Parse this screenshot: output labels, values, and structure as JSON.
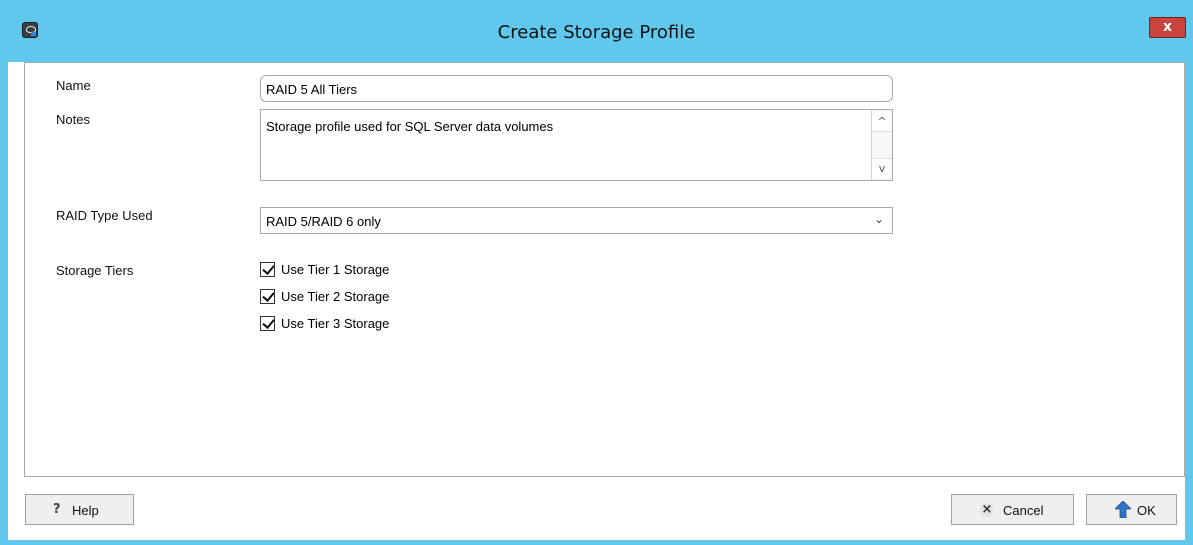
{
  "window": {
    "title": "Create Storage Profile",
    "close_label": "x",
    "titlebar_color": "#60c8ec"
  },
  "form": {
    "name_label": "Name",
    "name_value": "RAID 5 All Tiers",
    "notes_label": "Notes",
    "notes_value": "Storage profile used for SQL Server data volumes",
    "raid_label": "RAID Type Used",
    "raid_value": "RAID 5/RAID 6 only",
    "tiers_label": "Storage Tiers",
    "tiers": [
      {
        "label": "Use Tier 1 Storage",
        "checked": true
      },
      {
        "label": "Use Tier 2 Storage",
        "checked": true
      },
      {
        "label": "Use Tier 3 Storage",
        "checked": true
      }
    ]
  },
  "buttons": {
    "help": "Help",
    "cancel": "Cancel",
    "ok": "OK"
  },
  "icons": {
    "app": "storage-app-icon",
    "help": "question-mark-icon",
    "cancel": "x-circle-icon",
    "ok": "up-arrow-icon"
  }
}
